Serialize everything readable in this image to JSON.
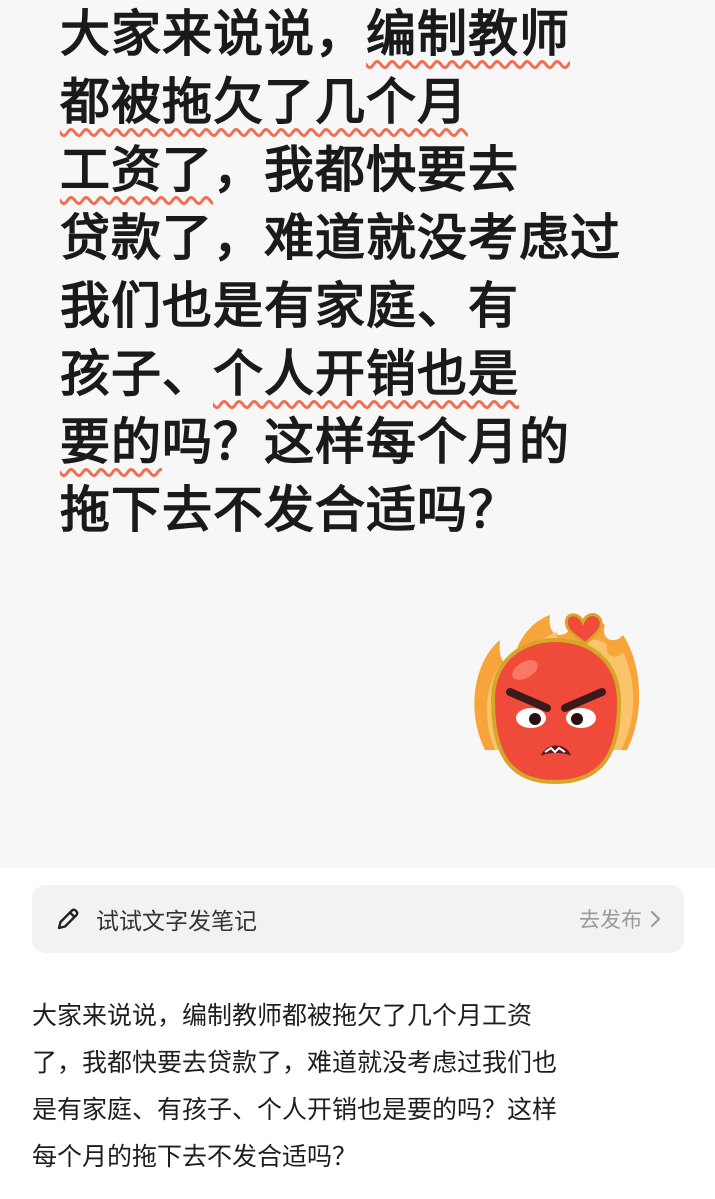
{
  "headline": {
    "line1_pre": "大家来说说，",
    "line1_hl": "编制教师",
    "line2_hl": "都被拖欠了几个月",
    "line3_hl": "工资了",
    "line3_post": "，我都快要去",
    "line4": "贷款了，难道就没考虑过",
    "line5": "我们也是有家庭、有",
    "line6_pre": "孩子、",
    "line6_hl": "个人开销也是",
    "line7_hl": "要的",
    "line7_post": "吗？这样每个月的",
    "line8": "拖下去不发合适吗？"
  },
  "emoji": {
    "icon": "angry-face-emoji",
    "colors": {
      "face": "#f04a3a",
      "flame": "#f7a53a",
      "outline": "#e0a020"
    }
  },
  "composer": {
    "icon": "pencil-icon",
    "prompt": "试试文字发笔记",
    "publish_label": "去发布",
    "publish_icon": "chevron-right-icon"
  },
  "body_text": {
    "lines": [
      "大家来说说，编制教师都被拖欠了几个月工资",
      "了，我都快要去贷款了，难道就没考虑过我们也",
      "是有家庭、有孩子、个人开销也是要的吗？这样",
      "每个月的拖下去不发合适吗？"
    ]
  },
  "colors": {
    "underline": "#ef6f55",
    "poster_bg": "#f7f7f7",
    "composer_bg": "#f2f2f2"
  }
}
